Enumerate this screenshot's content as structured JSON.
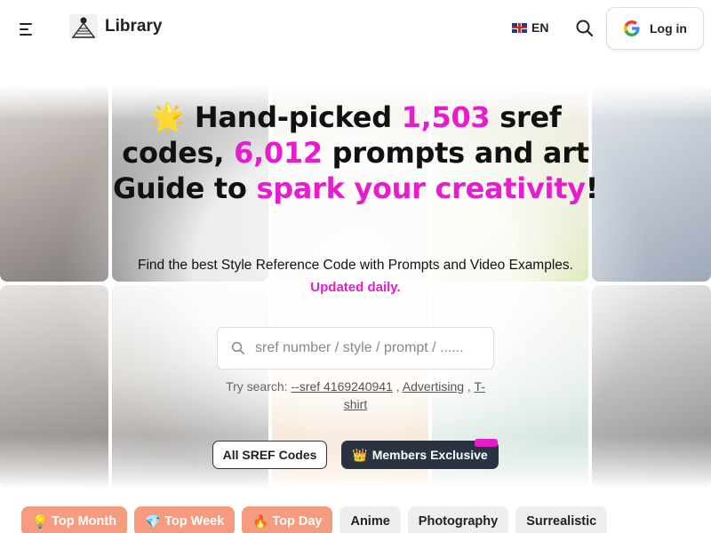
{
  "header": {
    "logo_text": "Library",
    "lang_label": "EN",
    "login_label": "Log in"
  },
  "hero": {
    "headline_parts": [
      {
        "text": "🌟 Hand-picked ",
        "accent": false
      },
      {
        "text": "1,503",
        "accent": true
      },
      {
        "text": " sref codes, ",
        "accent": false
      },
      {
        "text": "6,012",
        "accent": true
      },
      {
        "text": " prompts and art Guide to ",
        "accent": false
      },
      {
        "text": "spark your creativity",
        "accent": true
      },
      {
        "text": "!",
        "accent": false
      }
    ],
    "subtitle": "Find the best Style Reference Code with Prompts and Video Examples.",
    "updated": "Updated daily."
  },
  "search": {
    "placeholder": "sref number / style / prompt / ......",
    "try_label": "Try search:",
    "suggestions": [
      "--sref 4169240941",
      "Advertising",
      "T-shirt"
    ]
  },
  "actions": {
    "all_label": "All SREF Codes",
    "members_icon": "👑",
    "members_label": "Members Exclusive"
  },
  "chips": [
    {
      "icon": "💡",
      "label": "Top Month",
      "style": "hot"
    },
    {
      "icon": "💎",
      "label": "Top Week",
      "style": "hot"
    },
    {
      "icon": "🔥",
      "label": "Top Day",
      "style": "hot"
    },
    {
      "icon": "",
      "label": "Anime",
      "style": "plain"
    },
    {
      "icon": "",
      "label": "Photography",
      "style": "plain"
    },
    {
      "icon": "",
      "label": "Surrealistic",
      "style": "plain"
    }
  ],
  "colors": {
    "accent": "#e81ccf",
    "dark_button": "#2b3343",
    "hot_chip": "#f59b7f"
  }
}
